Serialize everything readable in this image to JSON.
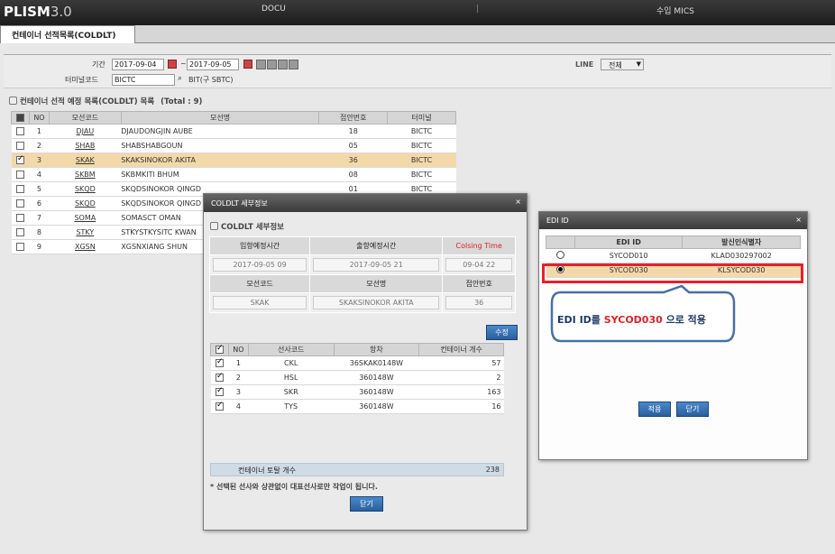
{
  "app": {
    "logo": "PLISM",
    "version": "3.0",
    "menu": [
      "DOCU",
      "|",
      "수입 MICS"
    ]
  },
  "tab": {
    "label": "컨테이너 선적목록(COLDLT)"
  },
  "filter": {
    "period_label": "기간",
    "date_from": "2017-09-04",
    "tilde": "~",
    "date_to": "2017-09-05",
    "terminal_label": "터미널코드",
    "terminal_code": "BICTC",
    "terminal_name": "BIT(구 SBTC)",
    "line_label": "LINE",
    "line_value": "전체"
  },
  "list": {
    "title": "컨테이너 선적 예정 목록(COLDLT) 목록",
    "total": "(Total : 9)",
    "headers": [
      "",
      "NO",
      "모선코드",
      "모선명",
      "접안번호",
      "터미널"
    ],
    "rows": [
      {
        "no": "1",
        "code": "DJAU",
        "name": "DJAUDONGJIN AUBE",
        "berth": "18",
        "terminal": "BICTC",
        "checked": false
      },
      {
        "no": "2",
        "code": "SHAB",
        "name": "SHABSHABGOUN",
        "berth": "05",
        "terminal": "BICTC",
        "checked": false
      },
      {
        "no": "3",
        "code": "SKAK",
        "name": "SKAKSINOKOR AKITA",
        "berth": "36",
        "terminal": "BICTC",
        "checked": true
      },
      {
        "no": "4",
        "code": "SKBM",
        "name": "SKBMKITI BHUM",
        "berth": "08",
        "terminal": "BICTC",
        "checked": false
      },
      {
        "no": "5",
        "code": "SKQD",
        "name": "SKQDSINOKOR QINGD",
        "berth": "01",
        "terminal": "BICTC",
        "checked": false
      },
      {
        "no": "6",
        "code": "SKQD",
        "name": "SKQDSINOKOR QINGD",
        "berth": "",
        "terminal": "",
        "checked": false
      },
      {
        "no": "7",
        "code": "SOMA",
        "name": "SOMASCT OMAN",
        "berth": "",
        "terminal": "",
        "checked": false
      },
      {
        "no": "8",
        "code": "STKY",
        "name": "STKYSTKYSITC KWAN",
        "berth": "",
        "terminal": "",
        "checked": false
      },
      {
        "no": "9",
        "code": "XGSN",
        "name": "XGSNXIANG SHUN",
        "berth": "",
        "terminal": "",
        "checked": false
      }
    ]
  },
  "detail": {
    "header": "COLDLT 세부정보",
    "section_title": "COLDLT 세부정보",
    "labels": {
      "arrival": "입항예정시간",
      "departure": "출항예정시간",
      "closing": "Colsing Time",
      "vessel_code": "모선코드",
      "vessel_name": "모선명",
      "berth": "접안번호"
    },
    "values": {
      "arrival": "2017-09-05 09",
      "departure": "2017-09-05 21",
      "closing": "09-04 22",
      "vessel_code": "SKAK",
      "vessel_name": "SKAKSINOKOR AKITA",
      "berth": "36"
    },
    "edit_button": "수정",
    "headers": [
      "",
      "NO",
      "선사코드",
      "항차",
      "컨테이너 개수"
    ],
    "rows": [
      {
        "no": "1",
        "carrier": "CKL",
        "voyage": "36SKAK0148W",
        "count": "57"
      },
      {
        "no": "2",
        "carrier": "HSL",
        "voyage": "360148W",
        "count": "2"
      },
      {
        "no": "3",
        "carrier": "SKR",
        "voyage": "360148W",
        "count": "163"
      },
      {
        "no": "4",
        "carrier": "TYS",
        "voyage": "360148W",
        "count": "16"
      }
    ],
    "total_label": "컨테이너 토탈 개수",
    "total_value": "238",
    "note": "* 선택된 선사와 상관없이 대표선사로만 작업이 됩니다.",
    "close_button": "닫기"
  },
  "edi": {
    "header": "EDI ID",
    "headers": [
      "",
      "EDI ID",
      "발신인식별자"
    ],
    "rows": [
      {
        "id": "SYCOD010",
        "sender": "KLAD030297002",
        "selected": false
      },
      {
        "id": "SYCOD030",
        "sender": "KLSYCOD030",
        "selected": true
      }
    ],
    "callout_prefix": "EDI ID를 ",
    "callout_highlight": "SYCOD030",
    "callout_suffix": " 으로 적용",
    "apply_button": "적용",
    "close_button": "닫기"
  },
  "colors": {
    "highlight": "#f3d9a9",
    "red_box": "#e8202a",
    "accent_red": "#d9232a",
    "callout_border": "#4a6fa5"
  }
}
